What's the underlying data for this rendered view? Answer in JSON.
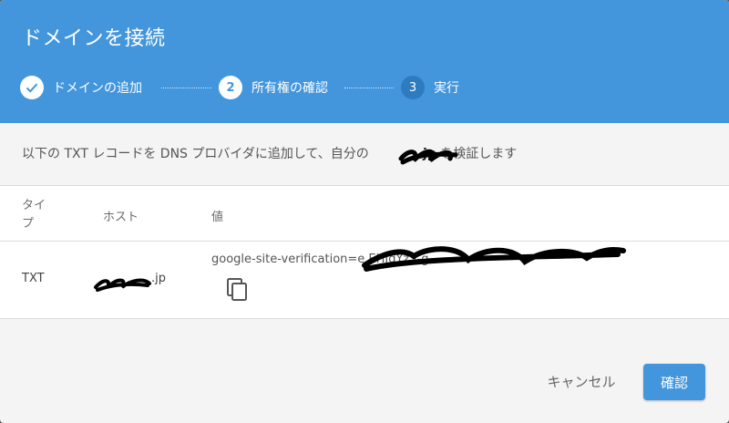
{
  "dialog": {
    "title": "ドメインを接続",
    "steps": [
      {
        "label": "ドメインの追加",
        "state": "done",
        "number": ""
      },
      {
        "label": "所有権の確認",
        "state": "active",
        "number": "2"
      },
      {
        "label": "実行",
        "state": "inactive",
        "number": "3"
      }
    ],
    "description": {
      "prefix": "以下の TXT レコードを DNS プロバイダに追加して、自分の",
      "domain": ".jp",
      "suffix": " を検証します"
    },
    "table": {
      "headers": {
        "type": "タイプ",
        "host": "ホスト",
        "value": "値"
      },
      "row": {
        "type": "TXT",
        "host": ".jp",
        "value": "google-site-verification=e                                              EHJqYz3-g"
      }
    },
    "buttons": {
      "cancel": "キャンセル",
      "confirm": "確認"
    }
  },
  "colors": {
    "accent": "#4396dc",
    "header_bg": "#4396dc",
    "step_inactive": "#2f7bc0"
  }
}
